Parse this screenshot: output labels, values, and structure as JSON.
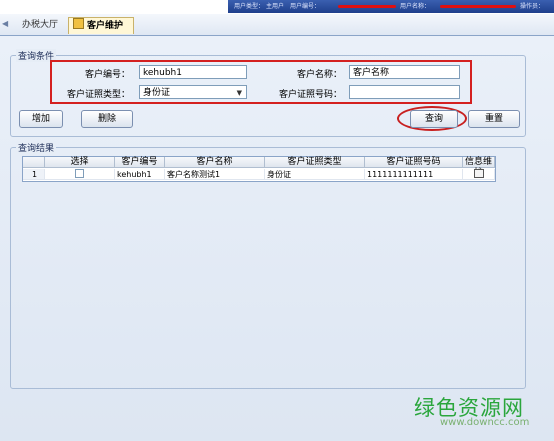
{
  "infobar": {
    "user_type_label": "用户类型：",
    "user_type_value": "主用户",
    "user_id_label": "用户编号：",
    "user_name_label": "用户名称：",
    "operator_label": "操作员："
  },
  "tabs": [
    {
      "label": "办税大厅"
    },
    {
      "label": "客户维护"
    }
  ],
  "query_conditions": {
    "title": "查询条件",
    "customer_id_label": "客户编号：",
    "customer_id_value": "kehubh1",
    "customer_name_label": "客户名称：",
    "customer_name_value": "客户名称",
    "id_type_label": "客户证照类型：",
    "id_type_value": "身份证",
    "id_number_label": "客户证照号码：",
    "id_number_value": ""
  },
  "buttons": {
    "add": "增加",
    "delete": "删除",
    "query": "查询",
    "reset": "重置"
  },
  "results": {
    "title": "查询结果",
    "columns": [
      "选择",
      "客户编号",
      "客户名称",
      "客户证照类型",
      "客户证照号码",
      "信息维护"
    ],
    "rows": [
      {
        "index": "1",
        "customer_id": "kehubh1",
        "customer_name": "客户名称测试1",
        "id_type": "身份证",
        "id_number": "1111111111111"
      }
    ]
  },
  "watermark": {
    "text": "绿色资源网",
    "url": "www.downcc.com"
  },
  "colors": {
    "highlight_red": "#d42020",
    "header_blue": "#1f3f8c",
    "watermark_green": "#2aa63c"
  }
}
